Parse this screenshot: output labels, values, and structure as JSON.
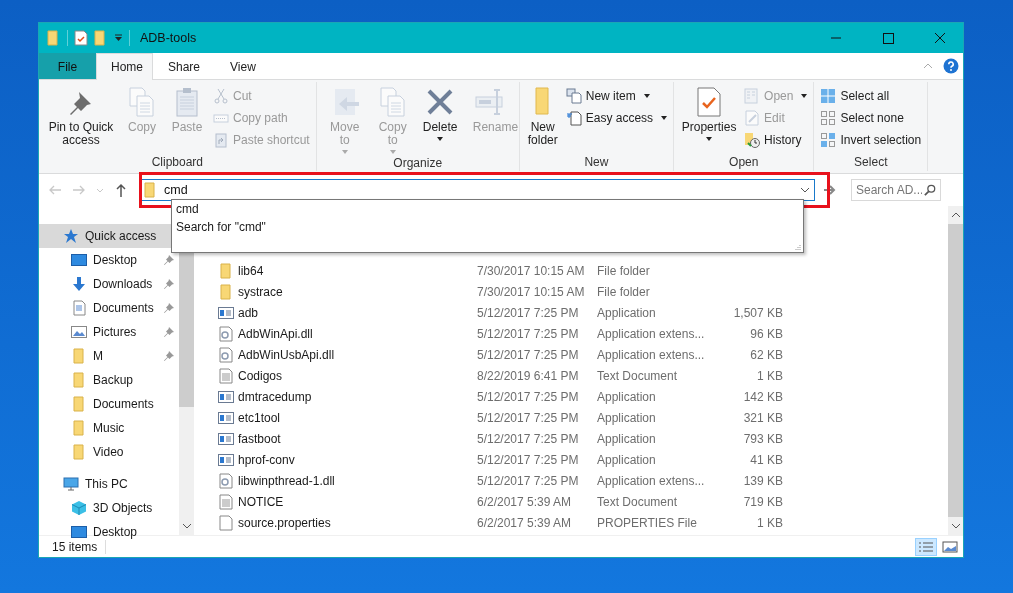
{
  "window": {
    "title": "ADB-tools"
  },
  "tabs": [
    {
      "label": "File",
      "kind": "file",
      "selected": false
    },
    {
      "label": "Home",
      "kind": "tab",
      "selected": true
    },
    {
      "label": "Share",
      "kind": "tab",
      "selected": false
    },
    {
      "label": "View",
      "kind": "tab",
      "selected": false
    }
  ],
  "ribbon": {
    "groups": [
      {
        "label": "Clipboard",
        "items": [
          {
            "kind": "large",
            "label": "Pin to Quick access",
            "disabled": false,
            "dropdown": false
          },
          {
            "kind": "large",
            "label": "Copy",
            "disabled": true,
            "dropdown": false
          },
          {
            "kind": "large",
            "label": "Paste",
            "disabled": true,
            "dropdown": false
          },
          {
            "kind": "small",
            "label": "Cut",
            "disabled": true,
            "dropdown": false
          },
          {
            "kind": "small",
            "label": "Copy path",
            "disabled": true,
            "dropdown": false
          },
          {
            "kind": "small",
            "label": "Paste shortcut",
            "disabled": true,
            "dropdown": false
          }
        ]
      },
      {
        "label": "Organize",
        "items": [
          {
            "kind": "large",
            "label": "Move to",
            "disabled": true,
            "dropdown": true
          },
          {
            "kind": "large",
            "label": "Copy to",
            "disabled": true,
            "dropdown": true
          },
          {
            "kind": "large",
            "label": "Delete",
            "disabled": false,
            "dropdown": true
          },
          {
            "kind": "large",
            "label": "Rename",
            "disabled": true,
            "dropdown": false
          }
        ]
      },
      {
        "label": "New",
        "items": [
          {
            "kind": "large",
            "label": "New folder",
            "disabled": false,
            "dropdown": false
          },
          {
            "kind": "small",
            "label": "New item",
            "disabled": false,
            "dropdown": true
          },
          {
            "kind": "small",
            "label": "Easy access",
            "disabled": false,
            "dropdown": true
          }
        ]
      },
      {
        "label": "Open",
        "items": [
          {
            "kind": "large",
            "label": "Properties",
            "disabled": false,
            "dropdown": true
          },
          {
            "kind": "small",
            "label": "Open",
            "disabled": true,
            "dropdown": true
          },
          {
            "kind": "small",
            "label": "Edit",
            "disabled": true,
            "dropdown": false
          },
          {
            "kind": "small",
            "label": "History",
            "disabled": false,
            "dropdown": false
          }
        ]
      },
      {
        "label": "Select",
        "items": [
          {
            "kind": "small",
            "label": "Select all",
            "disabled": false,
            "dropdown": false
          },
          {
            "kind": "small",
            "label": "Select none",
            "disabled": false,
            "dropdown": false
          },
          {
            "kind": "small",
            "label": "Invert selection",
            "disabled": false,
            "dropdown": false
          }
        ]
      }
    ]
  },
  "address": {
    "value": "cmd"
  },
  "search": {
    "placeholder": "Search AD..."
  },
  "highlight_frame": true,
  "suggestions": [
    "cmd",
    "Search for \"cmd\""
  ],
  "sidebar": {
    "items": [
      {
        "label": "Quick access",
        "kind": "star",
        "selected": true,
        "children": [
          {
            "label": "Desktop",
            "kind": "desktop",
            "pinned": true,
            "selected": false
          },
          {
            "label": "Downloads",
            "kind": "download",
            "pinned": true,
            "selected": false
          },
          {
            "label": "Documents",
            "kind": "documents",
            "pinned": true,
            "selected": false
          },
          {
            "label": "Pictures",
            "kind": "pictures",
            "pinned": true,
            "selected": false
          },
          {
            "label": "M",
            "kind": "folder",
            "pinned": true,
            "selected": false
          },
          {
            "label": "Backup",
            "kind": "folder",
            "pinned": false,
            "selected": false
          },
          {
            "label": "Documents",
            "kind": "folder",
            "pinned": false,
            "selected": false
          },
          {
            "label": "Music",
            "kind": "folder",
            "pinned": false,
            "selected": false
          },
          {
            "label": "Video",
            "kind": "folder",
            "pinned": false,
            "selected": false
          }
        ]
      },
      {
        "label": "This PC",
        "kind": "pc",
        "selected": false,
        "children": [
          {
            "label": "3D Objects",
            "kind": "cube",
            "pinned": false,
            "selected": false
          },
          {
            "label": "Desktop",
            "kind": "desktop",
            "pinned": false,
            "selected": false
          }
        ]
      }
    ]
  },
  "files": [
    {
      "name": "lib64",
      "kind": "folder",
      "date": "7/30/2017 10:15 AM",
      "type": "File folder"
    },
    {
      "name": "systrace",
      "kind": "folder",
      "date": "7/30/2017 10:15 AM",
      "type": "File folder"
    },
    {
      "name": "adb",
      "kind": "app",
      "date": "5/12/2017 7:25 PM",
      "type": "Application",
      "size": "1,507 KB"
    },
    {
      "name": "AdbWinApi.dll",
      "kind": "dll",
      "date": "5/12/2017 7:25 PM",
      "type": "Application extens...",
      "size": "96 KB"
    },
    {
      "name": "AdbWinUsbApi.dll",
      "kind": "dll",
      "date": "5/12/2017 7:25 PM",
      "type": "Application extens...",
      "size": "62 KB"
    },
    {
      "name": "Codigos",
      "kind": "text",
      "date": "8/22/2019 6:41 PM",
      "type": "Text Document",
      "size": "1 KB"
    },
    {
      "name": "dmtracedump",
      "kind": "app",
      "date": "5/12/2017 7:25 PM",
      "type": "Application",
      "size": "142 KB"
    },
    {
      "name": "etc1tool",
      "kind": "app",
      "date": "5/12/2017 7:25 PM",
      "type": "Application",
      "size": "321 KB"
    },
    {
      "name": "fastboot",
      "kind": "app",
      "date": "5/12/2017 7:25 PM",
      "type": "Application",
      "size": "793 KB"
    },
    {
      "name": "hprof-conv",
      "kind": "app",
      "date": "5/12/2017 7:25 PM",
      "type": "Application",
      "size": "41 KB"
    },
    {
      "name": "libwinpthread-1.dll",
      "kind": "dll",
      "date": "5/12/2017 7:25 PM",
      "type": "Application extens...",
      "size": "139 KB"
    },
    {
      "name": "NOTICE",
      "kind": "text",
      "date": "6/2/2017 5:39 AM",
      "type": "Text Document",
      "size": "719 KB"
    },
    {
      "name": "source.properties",
      "kind": "file",
      "date": "6/2/2017 5:39 AM",
      "type": "PROPERTIES File",
      "size": "1 KB"
    }
  ],
  "status_bar": {
    "count": "15 items",
    "views": [
      {
        "kind": "details",
        "selected": true
      },
      {
        "kind": "thumbs",
        "selected": false
      }
    ]
  }
}
